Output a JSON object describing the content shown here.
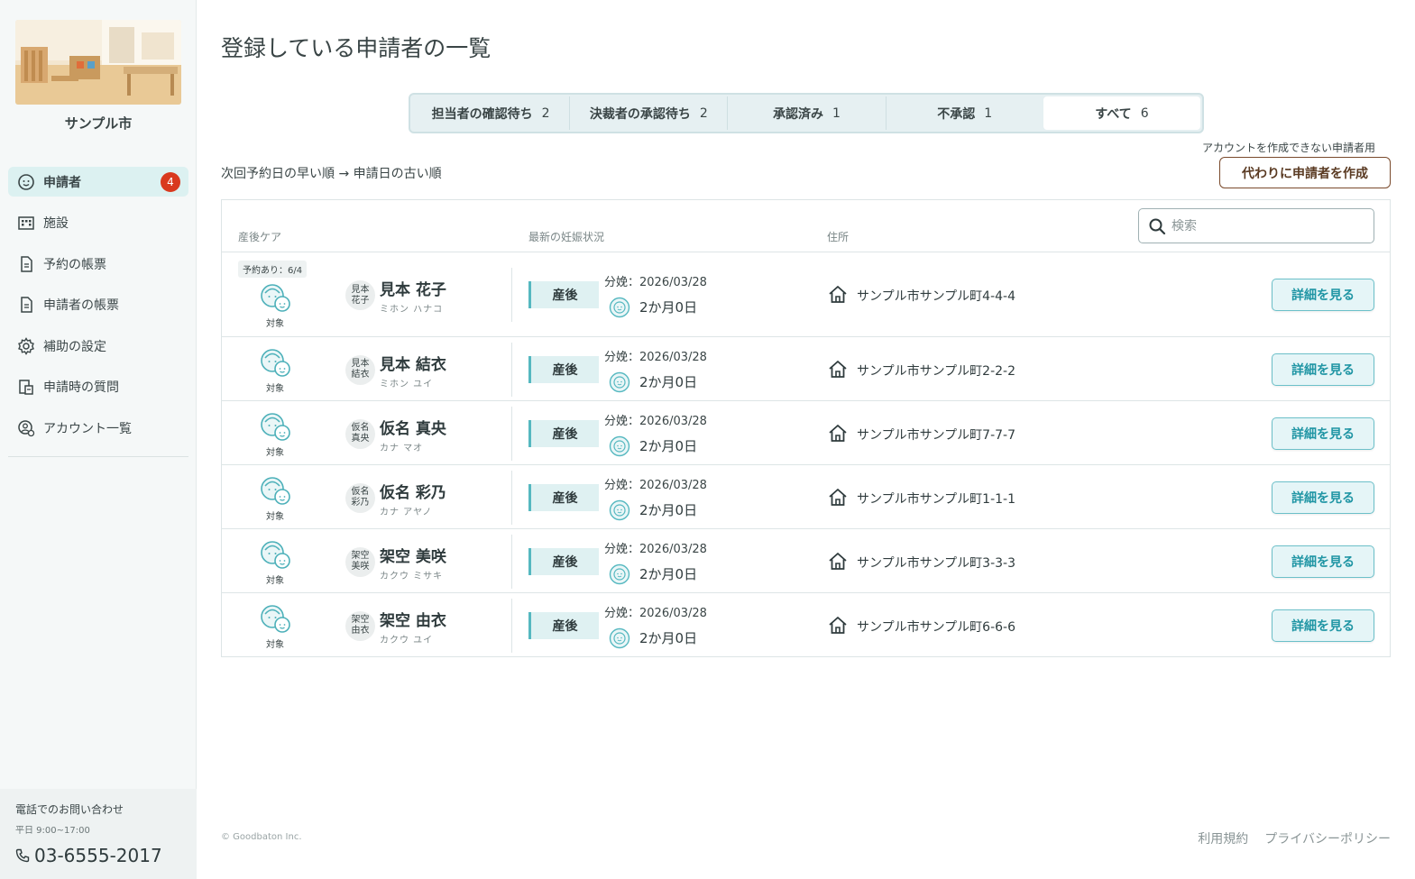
{
  "sidebar": {
    "city_name": "サンプル市",
    "items": [
      {
        "label": "申請者",
        "icon": "applicant-icon",
        "badge": "4",
        "active": true
      },
      {
        "label": "施設",
        "icon": "facility-icon"
      },
      {
        "label": "予約の帳票",
        "icon": "document-icon"
      },
      {
        "label": "申請者の帳票",
        "icon": "document-icon"
      },
      {
        "label": "補助の設定",
        "icon": "gear-icon"
      },
      {
        "label": "申請時の質問",
        "icon": "question-form-icon"
      },
      {
        "label": "アカウント一覧",
        "icon": "account-settings-icon"
      }
    ],
    "contact": {
      "title": "電話でのお問い合わせ",
      "hours": "平日 9:00~17:00",
      "phone": "03-6555-2017"
    }
  },
  "main": {
    "title": "登録している申請者の一覧",
    "tabs": [
      {
        "label": "担当者の確認待ち",
        "count": "2"
      },
      {
        "label": "決裁者の承認待ち",
        "count": "2"
      },
      {
        "label": "承認済み",
        "count": "1"
      },
      {
        "label": "不承認",
        "count": "1"
      },
      {
        "label": "すべて",
        "count": "6",
        "active": true
      }
    ],
    "sort_text": "次回予約日の早い順 → 申請日の古い順",
    "proxy_note": "アカウントを作成できない申請者用",
    "proxy_button": "代わりに申請者を作成",
    "table": {
      "headers": {
        "care": "産後ケア",
        "pregnancy": "最新の妊娠状況",
        "address": "住所"
      },
      "search_placeholder": "検索",
      "target_label": "対象",
      "detail_label": "詳細を見る",
      "rows": [
        {
          "reservation": "予約あり：6/4",
          "avatar1": "見本",
          "avatar2": "花子",
          "name": "見本 花子",
          "kana": "ミホン ハナコ",
          "status": "産後",
          "due": "分娩：2026/03/28",
          "age": "2か月0日",
          "address": "サンプル市サンプル町4-4-4"
        },
        {
          "avatar1": "見本",
          "avatar2": "結衣",
          "name": "見本 結衣",
          "kana": "ミホン ユイ",
          "status": "産後",
          "due": "分娩：2026/03/28",
          "age": "2か月0日",
          "address": "サンプル市サンプル町2-2-2"
        },
        {
          "avatar1": "仮名",
          "avatar2": "真央",
          "name": "仮名 真央",
          "kana": "カナ マオ",
          "status": "産後",
          "due": "分娩：2026/03/28",
          "age": "2か月0日",
          "address": "サンプル市サンプル町7-7-7"
        },
        {
          "avatar1": "仮名",
          "avatar2": "彩乃",
          "name": "仮名 彩乃",
          "kana": "カナ アヤノ",
          "status": "産後",
          "due": "分娩：2026/03/28",
          "age": "2か月0日",
          "address": "サンプル市サンプル町1-1-1"
        },
        {
          "avatar1": "架空",
          "avatar2": "美咲",
          "name": "架空 美咲",
          "kana": "カクウ ミサキ",
          "status": "産後",
          "due": "分娩：2026/03/28",
          "age": "2か月0日",
          "address": "サンプル市サンプル町3-3-3"
        },
        {
          "avatar1": "架空",
          "avatar2": "由衣",
          "name": "架空 由衣",
          "kana": "カクウ ユイ",
          "status": "産後",
          "due": "分娩：2026/03/28",
          "age": "2か月0日",
          "address": "サンプル市サンプル町6-6-6"
        }
      ]
    }
  },
  "footer": {
    "copyright": "© Goodbaton Inc.",
    "terms": "利用規約",
    "privacy": "プライバシーポリシー"
  },
  "colors": {
    "accent": "#1f95a4",
    "badge": "#d9391e",
    "proxy_border": "#7a4a2c"
  }
}
